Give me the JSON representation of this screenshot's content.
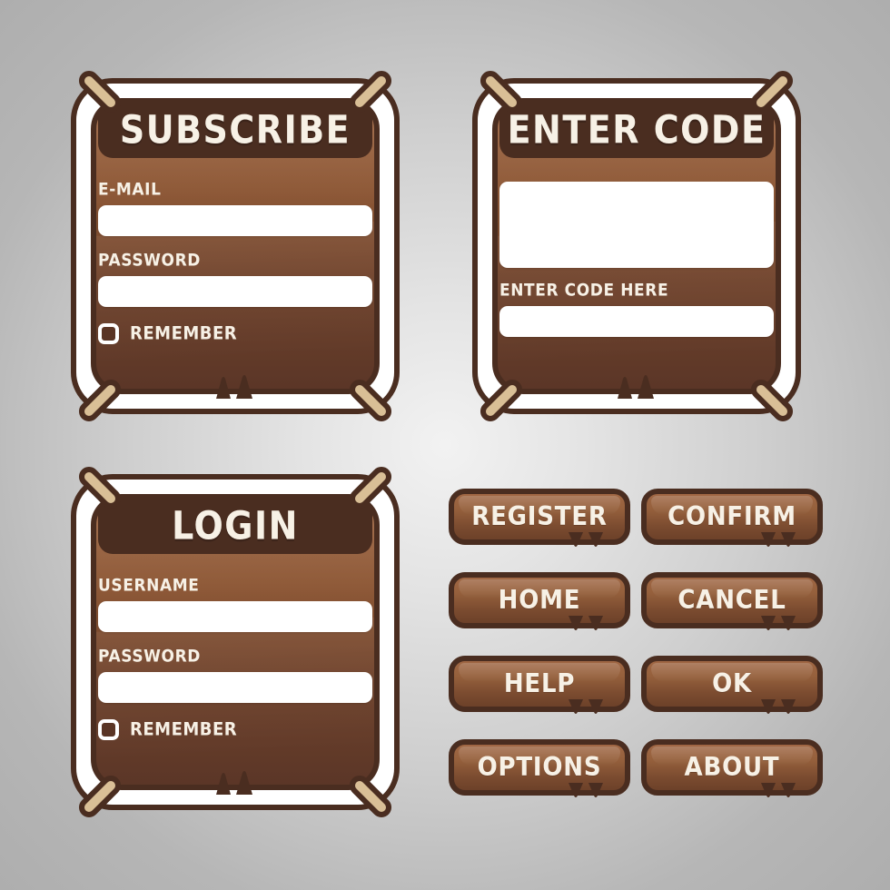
{
  "theme": {
    "background_start": "#f2f2f2",
    "background_end": "#aeaeae",
    "panel_brown_light": "#9d6440",
    "panel_brown_dark": "#5b3627",
    "outline_dark": "#4a2d20",
    "corner_tan": "#d9bf96",
    "text_cream": "#f7f1e6",
    "input_white": "#ffffff"
  },
  "panels": [
    {
      "id": "subscribe",
      "title": "SUBSCRIBE",
      "fields": [
        {
          "label": "E-MAIL",
          "value": "",
          "placeholder": ""
        },
        {
          "label": "PASSWORD",
          "value": "",
          "placeholder": ""
        }
      ],
      "checkbox": {
        "label": "REMEMBER",
        "checked": false
      }
    },
    {
      "id": "enter-code",
      "title": "ENTER CODE",
      "fields": [
        {
          "label": "",
          "value": "",
          "placeholder": ""
        },
        {
          "label": "ENTER CODE HERE",
          "value": "",
          "placeholder": ""
        }
      ],
      "checkbox": null
    },
    {
      "id": "login",
      "title": "LOGIN",
      "fields": [
        {
          "label": "USERNAME",
          "value": "",
          "placeholder": ""
        },
        {
          "label": "PASSWORD",
          "value": "",
          "placeholder": ""
        }
      ],
      "checkbox": {
        "label": "REMEMBER",
        "checked": false
      }
    }
  ],
  "buttons": [
    {
      "id": "register",
      "label": "REGISTER"
    },
    {
      "id": "confirm",
      "label": "CONFIRM"
    },
    {
      "id": "home",
      "label": "HOME"
    },
    {
      "id": "cancel",
      "label": "CANCEL"
    },
    {
      "id": "help",
      "label": "HELP"
    },
    {
      "id": "ok",
      "label": "OK"
    },
    {
      "id": "options",
      "label": "OPTIONS"
    },
    {
      "id": "about",
      "label": "ABOUT"
    }
  ],
  "icons": {
    "corner": "rope-peg-icon",
    "checkbox": "checkbox-icon",
    "drip": "drip-notch-icon"
  }
}
